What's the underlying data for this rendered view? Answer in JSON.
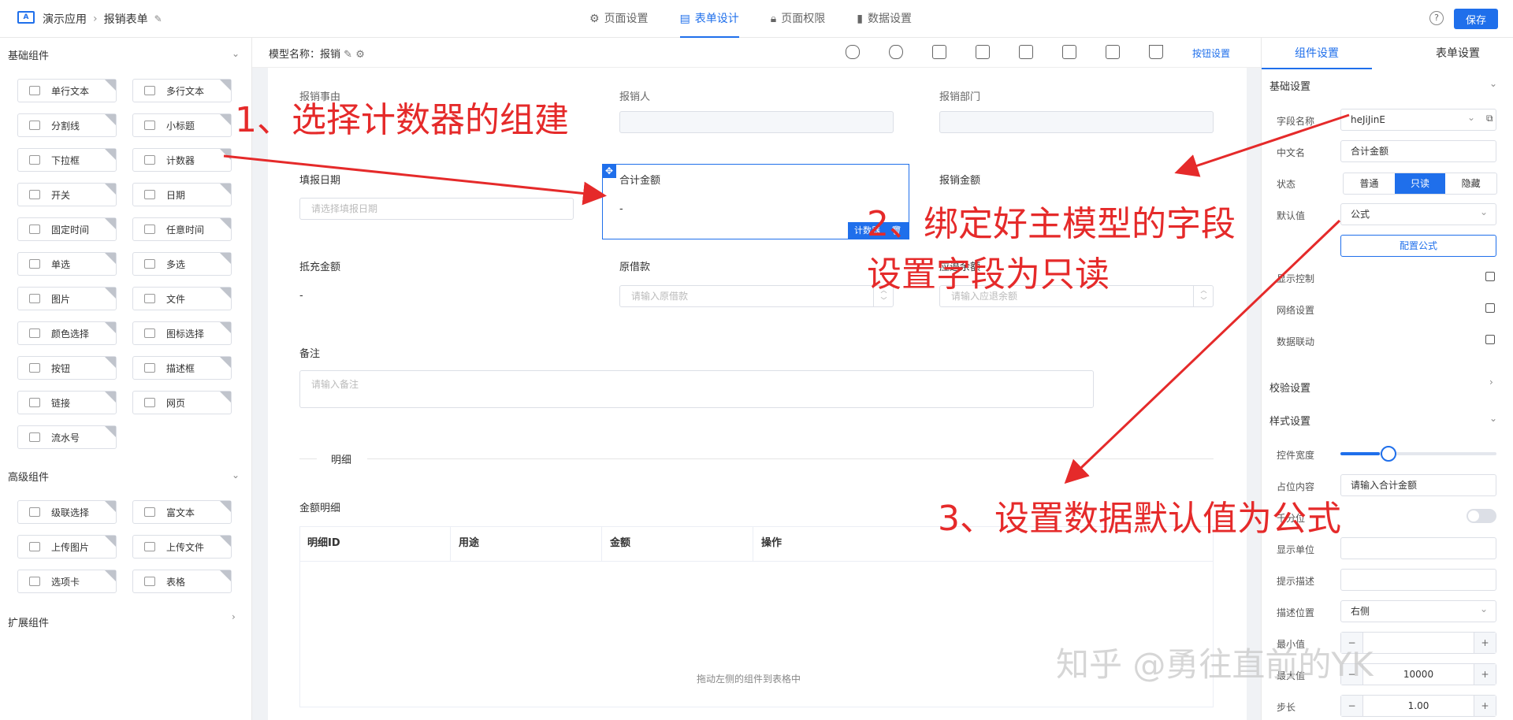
{
  "header": {
    "app_name": "演示应用",
    "form_name": "报销表单",
    "tabs": [
      {
        "label": "页面设置",
        "icon": "gear-icon"
      },
      {
        "label": "表单设计",
        "icon": "document-icon"
      },
      {
        "label": "页面权限",
        "icon": "lock-icon"
      },
      {
        "label": "数据设置",
        "icon": "bar-chart-icon"
      }
    ],
    "help": "?",
    "save": "保存"
  },
  "left": {
    "basic_title": "基础组件",
    "basic": [
      "单行文本",
      "多行文本",
      "分割线",
      "小标题",
      "下拉框",
      "计数器",
      "开关",
      "日期",
      "固定时间",
      "任意时间",
      "单选",
      "多选",
      "图片",
      "文件",
      "颜色选择",
      "图标选择",
      "按钮",
      "描述框",
      "链接",
      "网页",
      "流水号"
    ],
    "advanced_title": "高级组件",
    "advanced": [
      "级联选择",
      "富文本",
      "上传图片",
      "上传文件",
      "选项卡",
      "表格"
    ],
    "ext_title": "扩展组件"
  },
  "toolbar": {
    "model_label": "模型名称：报销",
    "button_settings": "按钮设置"
  },
  "form": {
    "reason": "报销事由",
    "applicant": "报销人",
    "dept": "报销部门",
    "date_label": "填报日期",
    "date_ph": "请选择填报日期",
    "total_label": "合计金额",
    "total_value": "-",
    "badge": "计数器",
    "reimb_label": "报销金额",
    "offset_label": "抵充金额",
    "offset_value": "-",
    "loan_label": "原借款",
    "loan_ph": "请输入原借款",
    "refund_label": "应退余额",
    "refund_ph": "请输入应退余额",
    "remark_label": "备注",
    "remark_ph": "请输入备注",
    "divider": "明细",
    "detail_label": "金额明细",
    "columns": [
      "明细ID",
      "用途",
      "金额",
      "操作"
    ],
    "table_hint": "拖动左侧的组件到表格中"
  },
  "right": {
    "tabs": [
      "组件设置",
      "表单设置"
    ],
    "basic_section": "基础设置",
    "field_name_label": "字段名称",
    "field_name": "heJiJinE",
    "cn_name_label": "中文名",
    "cn_name": "合计金额",
    "status_label": "状态",
    "status_options": [
      "普通",
      "只读",
      "隐藏"
    ],
    "default_label": "默认值",
    "default_value": "公式",
    "config_formula": "配置公式",
    "display_control": "显示控制",
    "grid_settings": "网络设置",
    "data_link": "数据联动",
    "validate_section": "校验设置",
    "style_section": "样式设置",
    "width_label": "控件宽度",
    "width_fraction": 0.25,
    "placeholder_label": "占位内容",
    "placeholder_value": "请输入合计金额",
    "thousands_label": "千分位",
    "unit_label": "显示单位",
    "hint_label": "提示描述",
    "desc_pos_label": "描述位置",
    "desc_pos": "右侧",
    "min_label": "最小值",
    "max_label": "最大值",
    "max_value": "10000",
    "step_label": "步长",
    "step_value": "1.00"
  },
  "annotations": {
    "step1": "1、选择计数器的组建",
    "step2a": "2、绑定好主模型的字段",
    "step2b": "设置字段为只读",
    "step3": "3、设置数据默认值为公式",
    "watermark": "知乎 @勇往直前的YK",
    "color": "#e52a2a"
  }
}
